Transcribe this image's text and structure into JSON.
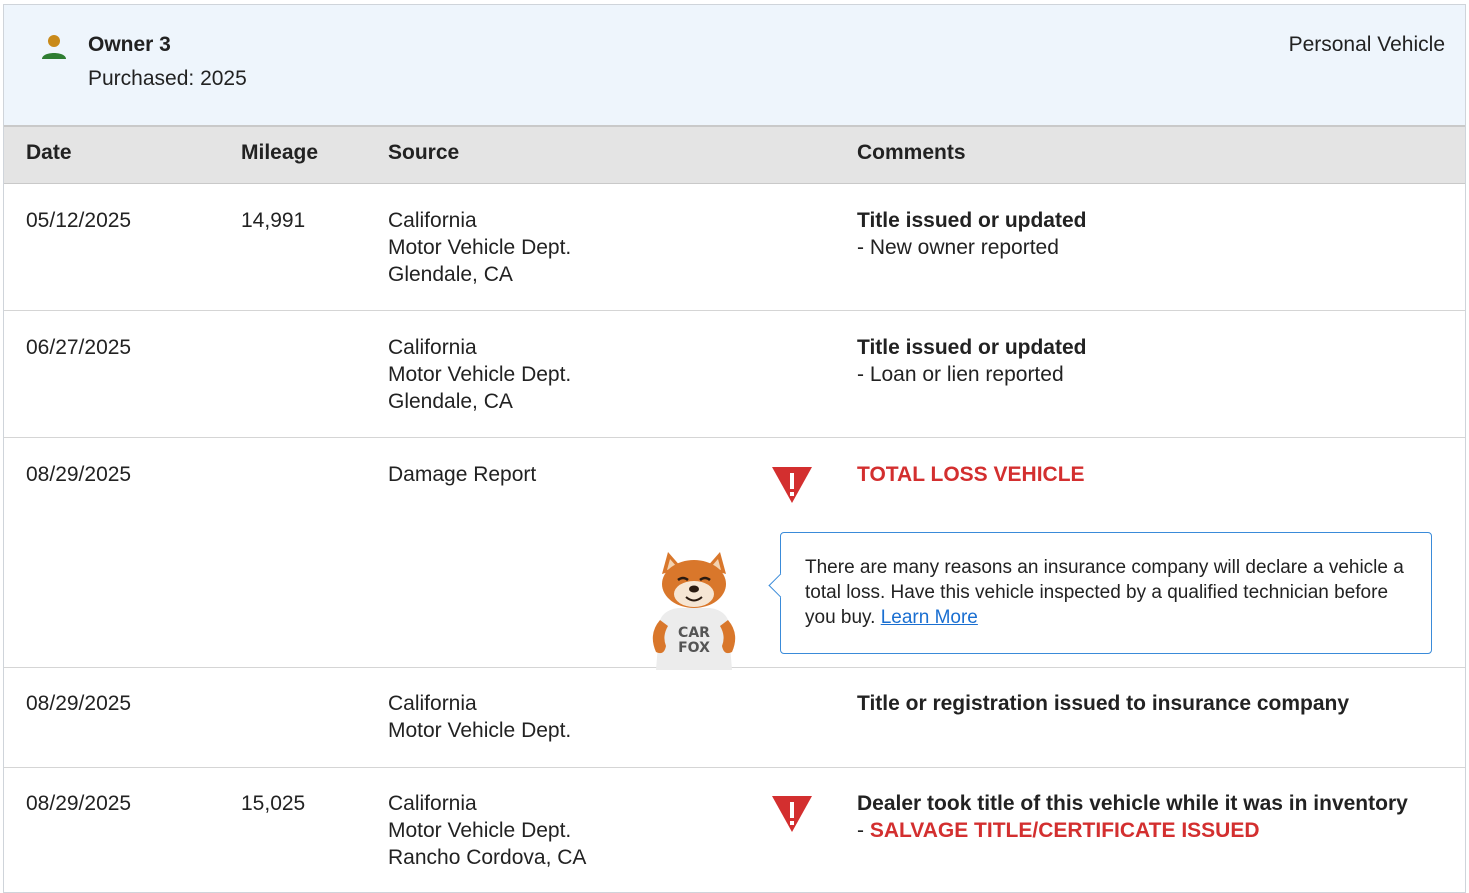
{
  "owner": {
    "title": "Owner 3",
    "purchased": "Purchased: 2025",
    "type": "Personal Vehicle"
  },
  "columns": {
    "date": "Date",
    "mileage": "Mileage",
    "source": "Source",
    "comments": "Comments"
  },
  "rows": [
    {
      "date": "05/12/2025",
      "mileage": "14,991",
      "source": [
        "California",
        "Motor Vehicle Dept.",
        "Glendale, CA"
      ],
      "comment_title": "Title issued or updated",
      "comment_detail": "- New owner reported"
    },
    {
      "date": "06/27/2025",
      "mileage": "",
      "source": [
        "California",
        "Motor Vehicle Dept.",
        "Glendale, CA"
      ],
      "comment_title": "Title issued or updated",
      "comment_detail": "- Loan or lien reported"
    },
    {
      "date": "08/29/2025",
      "mileage": "",
      "source": [
        "Damage Report"
      ],
      "comment_title": "TOTAL LOSS VEHICLE",
      "tooltip_text": "There are many reasons an insurance company will declare a vehicle a total loss. Have this vehicle inspected by a qualified technician before you buy.",
      "tooltip_link": "Learn More",
      "mascot_shirt": [
        "CAR",
        "FOX"
      ]
    },
    {
      "date": "08/29/2025",
      "mileage": "",
      "source": [
        "California",
        "Motor Vehicle Dept."
      ],
      "comment_title": "Title or registration issued to insurance company"
    },
    {
      "date": "08/29/2025",
      "mileage": "15,025",
      "source": [
        "California",
        "Motor Vehicle Dept.",
        "Rancho Cordova, CA"
      ],
      "comment_title": "Dealer took title of this vehicle while it was in inventory",
      "comment_dash": "- ",
      "comment_alert": "SALVAGE TITLE/CERTIFICATE ISSUED"
    }
  ],
  "colors": {
    "alert_red": "#d32f2f",
    "link_blue": "#1a6fd1",
    "owner_green": "#2e7d32",
    "header_bg": "#eef5fc"
  },
  "icons": {
    "owner": "person-icon",
    "alert": "warning-triangle-icon"
  }
}
